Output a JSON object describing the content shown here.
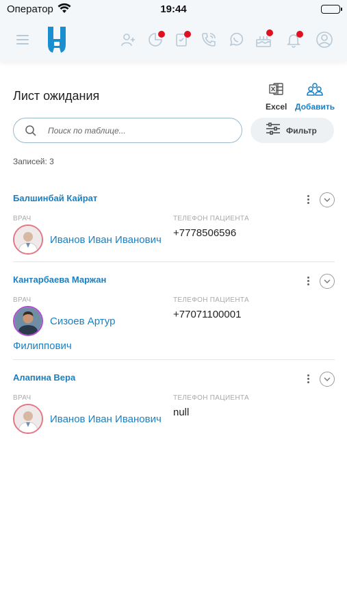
{
  "status_bar": {
    "carrier": "Оператор",
    "time": "19:44"
  },
  "nav": {
    "icons": [
      "menu-icon",
      "app-logo-icon",
      "add-patient-icon",
      "chart-pie-icon",
      "clipboard-icon",
      "phone-call-icon",
      "whatsapp-icon",
      "birthday-cake-icon",
      "bell-icon",
      "profile-icon"
    ],
    "notification_color": "#e01020"
  },
  "page": {
    "title": "Лист ожидания",
    "excel_label": "Excel",
    "add_label": "Добавить",
    "search_placeholder": "Поиск по таблице...",
    "filter_label": "Фильтр",
    "records_count": "Записей: 3",
    "accent": "#1a7fc1"
  },
  "labels": {
    "doctor": "ВРАЧ",
    "phone": "ТЕЛЕФОН ПАЦИЕНТА"
  },
  "records": [
    {
      "patient": "Балшинбай Кайрат",
      "doctor_name": "Иванов Иван Иванович",
      "phone": "+7778506596"
    },
    {
      "patient": "Кантарбаева Маржан",
      "doctor_name_line1": "Сизоев Артур",
      "doctor_name_line2": "Филиппович",
      "phone": "+77071100001"
    },
    {
      "patient": "Алапина Вера",
      "doctor_name": "Иванов Иван Иванович",
      "phone": "null"
    }
  ]
}
